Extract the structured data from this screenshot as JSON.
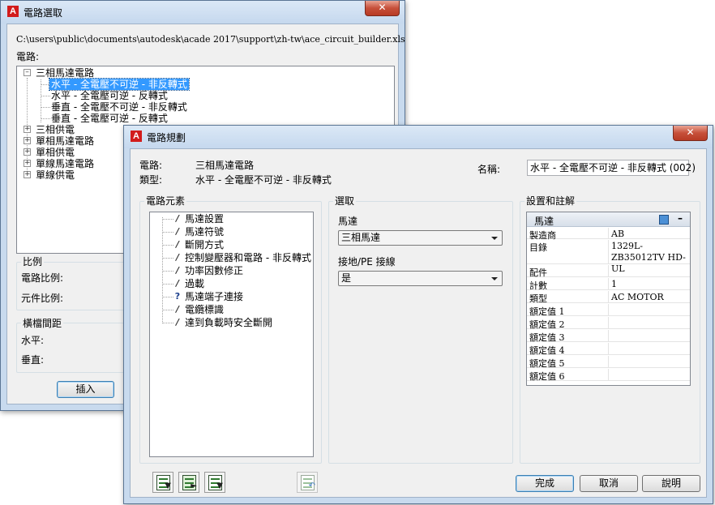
{
  "circuit_select_dialog": {
    "title": "電路選取",
    "close": "✕",
    "file_path": "C:\\users\\public\\documents\\autodesk\\acade 2017\\support\\zh-tw\\ace_circuit_builder.xls",
    "circuit_label": "電路:",
    "tree": [
      {
        "label": "三相馬達電路",
        "expanded": true,
        "children": [
          {
            "label": "水平 - 全電壓不可逆 - 非反轉式",
            "selected": true
          },
          {
            "label": "水平 - 全電壓可逆 - 反轉式"
          },
          {
            "label": "垂直 - 全電壓不可逆 - 非反轉式"
          },
          {
            "label": "垂直 - 全電壓可逆 - 反轉式"
          }
        ]
      },
      {
        "label": "三相供電"
      },
      {
        "label": "單相馬達電路"
      },
      {
        "label": "單相供電"
      },
      {
        "label": "單線馬達電路"
      },
      {
        "label": "單線供電"
      }
    ],
    "scale_group": "比例",
    "circuit_scale": "電路比例:",
    "component_scale": "元件比例:",
    "spacing_group": "橫檔間距",
    "horizontal": "水平:",
    "vertical": "垂直:",
    "insert_button": "插入"
  },
  "circuit_config_dialog": {
    "title": "電路規劃",
    "close": "✕",
    "circuit_label": "電路:",
    "circuit_value": "三相馬達電路",
    "type_label": "類型:",
    "type_value": "水平 - 全電壓不可逆 - 非反轉式",
    "name_label": "名稱:",
    "name_value": "水平 - 全電壓不可逆 - 非反轉式 (002)",
    "elements_group": "電路元素",
    "elements": [
      {
        "label": "馬達設置",
        "icon": "pencil"
      },
      {
        "label": "馬達符號",
        "icon": "pencil"
      },
      {
        "label": "斷開方式",
        "icon": "pencil"
      },
      {
        "label": "控制變壓器和電路 - 非反轉式",
        "icon": "pencil"
      },
      {
        "label": "功率因數修正",
        "icon": "pencil"
      },
      {
        "label": "過載",
        "icon": "pencil"
      },
      {
        "label": "馬達端子連接",
        "icon": "question"
      },
      {
        "label": "電纜標識",
        "icon": "pencil"
      },
      {
        "label": "達到負載時安全斷開",
        "icon": "pencil"
      }
    ],
    "pencil_glyph": "/",
    "question_glyph": "?",
    "select_group": "選取",
    "motor_label": "馬達",
    "motor_value": "三相馬達",
    "ground_label": "接地/PE 接線",
    "ground_value": "是",
    "settings_group": "設置和註解",
    "props_header": "馬達",
    "props_collapse": "–",
    "properties": [
      {
        "name": "製造商",
        "value": "AB"
      },
      {
        "name": "目錄",
        "value": "1329L-ZB35012TV HD-UL"
      },
      {
        "name": "配件",
        "value": ""
      },
      {
        "name": "計數",
        "value": "1"
      },
      {
        "name": "類型",
        "value": "AC MOTOR"
      },
      {
        "name": "額定值 1",
        "value": ""
      },
      {
        "name": "額定值 2",
        "value": ""
      },
      {
        "name": "額定值 3",
        "value": ""
      },
      {
        "name": "額定值 4",
        "value": ""
      },
      {
        "name": "額定值 5",
        "value": ""
      },
      {
        "name": "額定值 6",
        "value": ""
      }
    ],
    "finish_button": "完成",
    "cancel_button": "取消",
    "help_button": "說明"
  }
}
